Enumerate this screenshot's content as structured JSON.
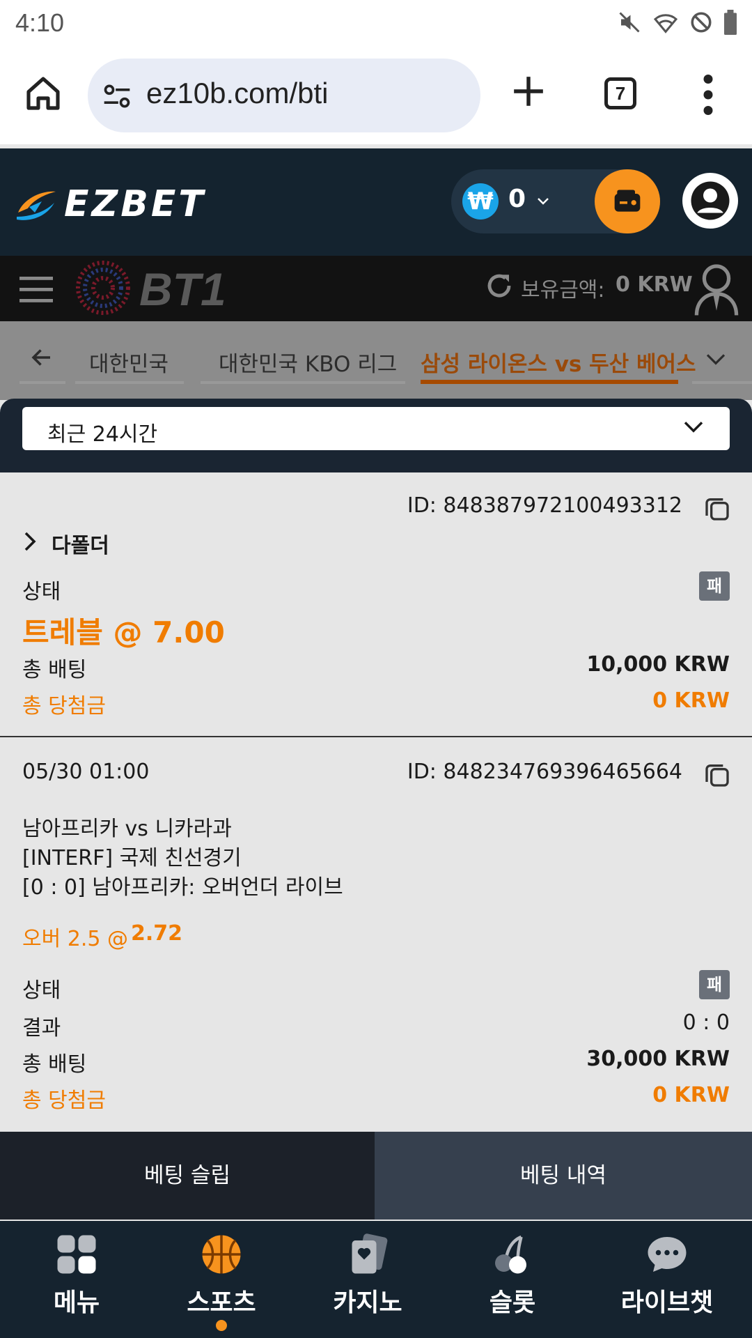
{
  "status_bar": {
    "time": "4:10"
  },
  "browser": {
    "url": "ez10b.com/bti",
    "tab_count": "7"
  },
  "header": {
    "logo_text": "EZBET",
    "currency_symbol": "₩",
    "balance": "0"
  },
  "bt_bar": {
    "logo_text": "BT1",
    "balance_label": "보유금액:",
    "balance_value": "0 KRW"
  },
  "breadcrumb": {
    "items": [
      "대한민국",
      "대한민국 KBO 리그",
      "삼성 라이온스 vs 두산 베어스"
    ]
  },
  "filter": {
    "selected": "최근 24시간"
  },
  "bets": [
    {
      "id": "ID: 848387972100493312",
      "expand_label": "다폴더",
      "status_label": "상태",
      "status_badge": "패",
      "bet_type": "트레블 @ 7.00",
      "total_bet_label": "총 배팅",
      "total_bet_value": "10,000 KRW",
      "total_win_label": "총 당첨금",
      "total_win_value": "0 KRW"
    },
    {
      "date": "05/30 01:00",
      "id": "ID: 848234769396465664",
      "match": "남아프리카 vs 니카라과",
      "league": "[INTERF] 국제 친선경기",
      "market": "[0 : 0] 남아프리카: 오버언더 라이브",
      "selection": "오버 2.5 @",
      "odds": "2.72",
      "status_label": "상태",
      "status_badge": "패",
      "result_label": "결과",
      "result_value": "0 : 0",
      "total_bet_label": "총 배팅",
      "total_bet_value": "30,000 KRW",
      "total_win_label": "총 당첨금",
      "total_win_value": "0 KRW"
    }
  ],
  "bet_tabs": {
    "slip": "베팅 슬립",
    "history": "베팅 내역"
  },
  "bottom_nav": [
    {
      "label": "메뉴",
      "icon": "grid-icon"
    },
    {
      "label": "스포츠",
      "icon": "basketball-icon"
    },
    {
      "label": "카지노",
      "icon": "cards-icon"
    },
    {
      "label": "슬롯",
      "icon": "cherry-icon"
    },
    {
      "label": "라이브챗",
      "icon": "chat-icon"
    }
  ],
  "colors": {
    "accent": "#f07c00",
    "header_bg": "#14232f",
    "wallet": "#f7931e"
  }
}
